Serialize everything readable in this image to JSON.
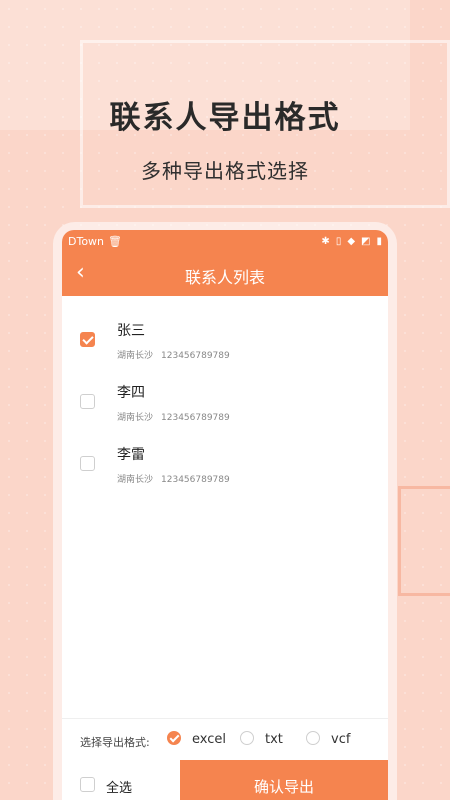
{
  "promo": {
    "headline": "联系人导出格式",
    "subline": "多种导出格式选择"
  },
  "statusbar": {
    "carrier": "DTown",
    "icons": [
      "trash-icon",
      "bluetooth-icon",
      "vibrate-icon",
      "wifi-icon",
      "no-sim-icon",
      "battery-icon"
    ]
  },
  "titlebar": {
    "title": "联系人列表",
    "back_icon": "chevron-left-icon"
  },
  "contacts": [
    {
      "name": "张三",
      "location": "湖南长沙",
      "phone": "123456789789",
      "checked": true
    },
    {
      "name": "李四",
      "location": "湖南长沙",
      "phone": "123456789789",
      "checked": false
    },
    {
      "name": "李雷",
      "location": "湖南长沙",
      "phone": "123456789789",
      "checked": false
    }
  ],
  "export_format": {
    "label": "选择导出格式:",
    "options": [
      {
        "label": "excel",
        "selected": true
      },
      {
        "label": "txt",
        "selected": false
      },
      {
        "label": "vcf",
        "selected": false
      }
    ]
  },
  "bottom": {
    "select_all": "全选",
    "confirm": "确认导出"
  },
  "colors": {
    "accent": "#f5844f",
    "background": "#fbd6c9"
  }
}
